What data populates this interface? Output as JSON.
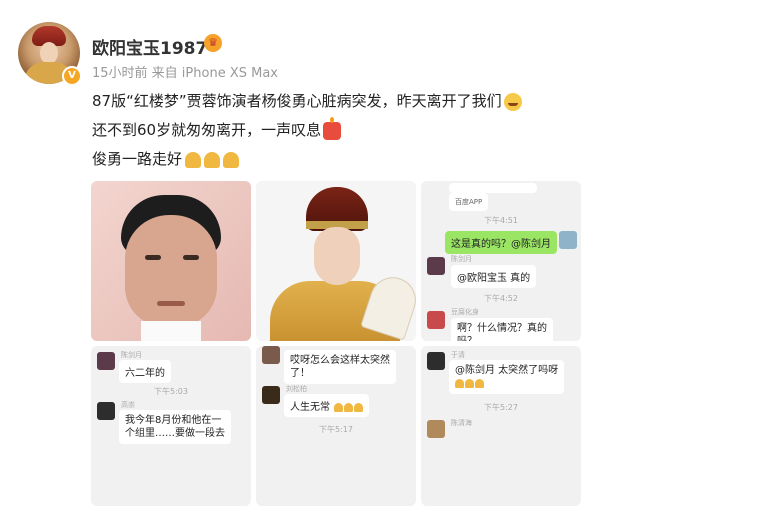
{
  "post": {
    "username": "欧阳宝玉1987",
    "verified_badge": "V",
    "meta": "15小时前 来自 iPhone XS Max",
    "line1": "87版“红楼梦”贾蓉饰演者杨俊勇心脏病突发，昨天离开了我们",
    "line2": "还不到60岁就匆匆离开，一声叹息",
    "line3": "俊勇一路走好",
    "accent_color": "#f5a623"
  },
  "chat3": {
    "app_label": "百度APP",
    "time1": "下午4:51",
    "msg_green": "这是真的吗？@陈剑月",
    "name1": "陈剑月",
    "msg1": "@欧阳宝玉 真的",
    "time2": "下午4:52",
    "name2": "豆腐化身",
    "msg2a": "啊？什么情况？真的",
    "msg2b": "吗？"
  },
  "chat4": {
    "name1": "陈剑月",
    "msg1": "六二年的",
    "time1": "下午5:03",
    "name2": "高崇",
    "msg2a": "我今年8月份和他在一",
    "msg2b": "个组里……要做一段去"
  },
  "chat5": {
    "msg1a": "哎呀怎么会这样太突然",
    "msg1b": "了！",
    "name2": "刘松柏",
    "msg2": "人生无常",
    "time1": "下午5:17"
  },
  "chat6": {
    "name1": "于清",
    "msg1": "@陈剑月 太突然了吗呀",
    "time1": "下午5:27",
    "name2": "陈清海"
  }
}
